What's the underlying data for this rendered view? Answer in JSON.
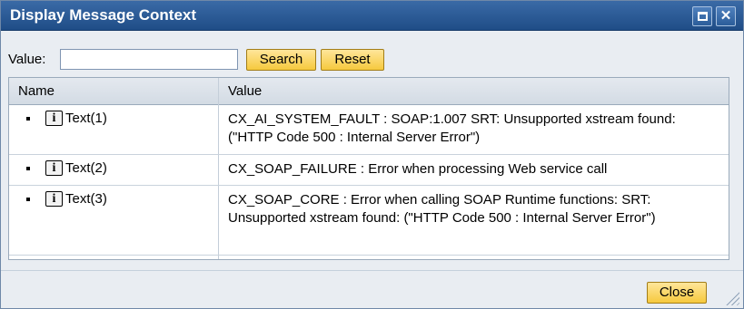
{
  "dialog": {
    "title": "Display Message Context",
    "maximize_icon": "maximize-icon",
    "close_icon": "close-icon"
  },
  "search": {
    "label": "Value:",
    "value": "",
    "placeholder": "",
    "search_label": "Search",
    "reset_label": "Reset"
  },
  "table": {
    "columns": [
      "Name",
      "Value"
    ],
    "rows": [
      {
        "name": "Text(1)",
        "value": "CX_AI_SYSTEM_FAULT : SOAP:1.007 SRT: Unsupported xstream found: (\"HTTP Code 500 : Internal Server Error\")",
        "icon": "info-icon"
      },
      {
        "name": "Text(2)",
        "value": "CX_SOAP_FAILURE : Error when processing Web service call",
        "icon": "info-icon"
      },
      {
        "name": "Text(3)",
        "value": "CX_SOAP_CORE : Error when calling SOAP Runtime functions: SRT: Unsupported xstream found: (\"HTTP Code 500 : Internal Server Error\")",
        "icon": "info-icon"
      }
    ]
  },
  "footer": {
    "close_label": "Close"
  },
  "colors": {
    "title_bar": "#2b5d9a",
    "button_fill": "#f6c93e",
    "dialog_bg": "#e9edf2"
  }
}
